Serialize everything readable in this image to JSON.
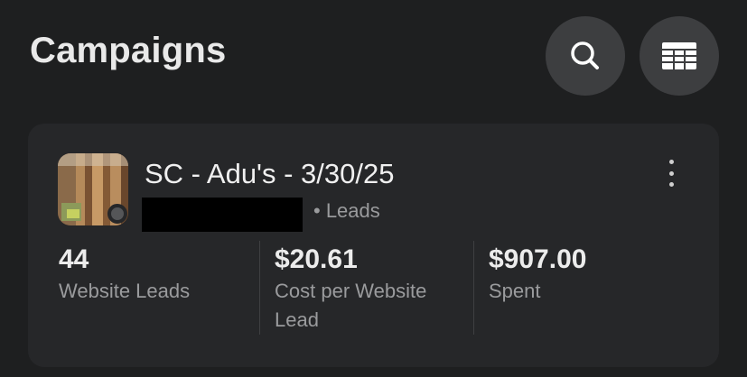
{
  "header": {
    "title": "Campaigns"
  },
  "campaign": {
    "name": "SC - Adu's - 3/30/25",
    "objective": "• Leads",
    "metrics": [
      {
        "value": "44",
        "label": "Website Leads"
      },
      {
        "value": "$20.61",
        "label": "Cost per Website Lead"
      },
      {
        "value": "$907.00",
        "label": "Spent"
      }
    ]
  },
  "icons": {
    "search": "search-icon",
    "table": "table-icon",
    "more": "more-vertical-icon"
  },
  "colors": {
    "background": "#1e1f20",
    "card": "#262729",
    "button": "#3d3e40"
  }
}
